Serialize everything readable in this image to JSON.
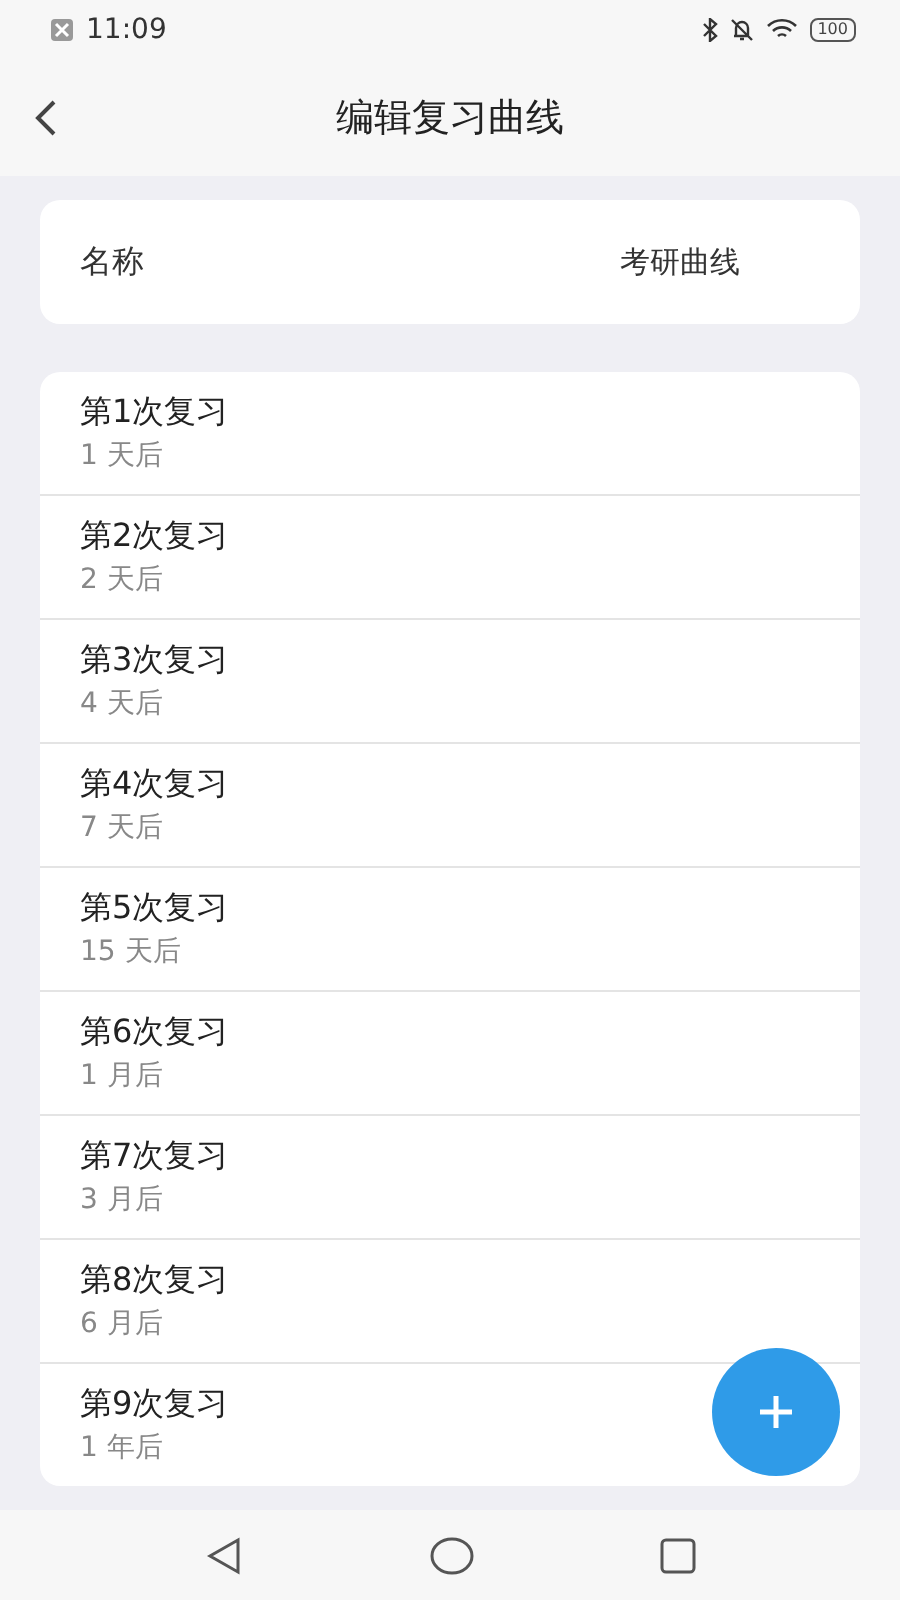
{
  "status_bar": {
    "time": "11:09",
    "battery": "100"
  },
  "header": {
    "title": "编辑复习曲线"
  },
  "name_field": {
    "label": "名称",
    "value": "考研曲线"
  },
  "reviews": [
    {
      "title": "第1次复习",
      "interval": "1 天后"
    },
    {
      "title": "第2次复习",
      "interval": "2 天后"
    },
    {
      "title": "第3次复习",
      "interval": "4 天后"
    },
    {
      "title": "第4次复习",
      "interval": "7 天后"
    },
    {
      "title": "第5次复习",
      "interval": "15 天后"
    },
    {
      "title": "第6次复习",
      "interval": "1 月后"
    },
    {
      "title": "第7次复习",
      "interval": "3 月后"
    },
    {
      "title": "第8次复习",
      "interval": "6 月后"
    },
    {
      "title": "第9次复习",
      "interval": "1 年后"
    }
  ]
}
